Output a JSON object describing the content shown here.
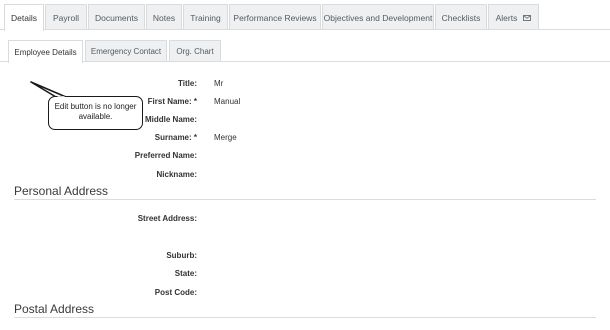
{
  "main_tabs": [
    {
      "label": "Details"
    },
    {
      "label": "Payroll"
    },
    {
      "label": "Documents"
    },
    {
      "label": "Notes"
    },
    {
      "label": "Training"
    },
    {
      "label": "Performance Reviews"
    },
    {
      "label": "Objectives and Development"
    },
    {
      "label": "Checklists"
    },
    {
      "label": "Alerts",
      "icon": "mail-icon"
    }
  ],
  "sub_tabs": [
    {
      "label": "Employee Details"
    },
    {
      "label": "Emergency Contact"
    },
    {
      "label": "Org. Chart"
    }
  ],
  "employee": {
    "title_label": "Title:",
    "title_value": "Mr",
    "first_name_label": "First Name: *",
    "first_name_value": "Manual",
    "middle_name_label": "Middle Name:",
    "surname_label": "Surname: *",
    "surname_value": "Merge",
    "preferred_name_label": "Preferred Name:",
    "nickname_label": "Nickname:"
  },
  "personal_address": {
    "heading": "Personal Address",
    "street_label": "Street Address:",
    "suburb_label": "Suburb:",
    "state_label": "State:",
    "postcode_label": "Post Code:"
  },
  "postal_address": {
    "heading": "Postal Address"
  },
  "callout": {
    "text": "Edit button is no longer available."
  }
}
